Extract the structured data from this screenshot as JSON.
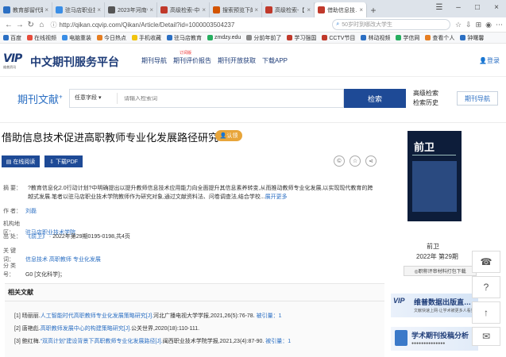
{
  "browser": {
    "tabs": [
      {
        "label": "教育部留代职…",
        "color": "#2b6fc3",
        "active": false
      },
      {
        "label": "驻马店职业技…",
        "color": "#3a8ee6",
        "active": false
      },
      {
        "label": "2023年河南省…",
        "color": "#555555",
        "active": false
      },
      {
        "label": "高级检索-中国…",
        "color": "#c0392b",
        "active": false
      },
      {
        "label": "搜索预览下的…",
        "color": "#d35400",
        "active": false
      },
      {
        "label": "高级检索-【…",
        "color": "#c0392b",
        "active": false
      },
      {
        "label": "借助信息技…",
        "color": "#c0392b",
        "active": true
      }
    ],
    "new_tab": "+",
    "url": "http://qikan.cqvip.com/Qikan/Article/Detail?id=1000003504237",
    "search_placeholder": "50岁时到哪改大学生",
    "bookmarks": [
      {
        "label": "百度",
        "color": "#2b6fc3"
      },
      {
        "label": "在线视频",
        "color": "#e74c3c"
      },
      {
        "label": "电脑重装",
        "color": "#3a8ee6"
      },
      {
        "label": "今日热点",
        "color": "#e67e22"
      },
      {
        "label": "手机收藏",
        "color": "#f1c40f"
      },
      {
        "label": "驻马店教育",
        "color": "#2b6fc3"
      },
      {
        "label": "zmdzy.edu",
        "color": "#27ae60"
      },
      {
        "label": "分前年前了",
        "color": "#888888"
      },
      {
        "label": "学习强国",
        "color": "#c0392b"
      },
      {
        "label": "CCTV节目",
        "color": "#c0392b"
      },
      {
        "label": "林动视频",
        "color": "#2b6fc3"
      },
      {
        "label": "学信网",
        "color": "#27ae60"
      },
      {
        "label": "查看个人",
        "color": "#e67e22"
      },
      {
        "label": "钟曙馨",
        "color": "#2b6fc3"
      }
    ]
  },
  "site": {
    "logo_text": "VIP",
    "logo_sub": "维普资讯",
    "title": "中文期刊服务平台",
    "nav": [
      "期刊导航",
      "期刊评价报告",
      "期刊开放获取",
      "下载APP"
    ],
    "nav_badge": "订阅版",
    "login": "登录"
  },
  "search": {
    "brand": "期刊文献",
    "brand_sup": "+",
    "scope": "任意字段",
    "placeholder": "请输入检索词",
    "button": "检索",
    "advanced": "高级检索",
    "history": "检索历史",
    "journal_nav": "期刊导航"
  },
  "article": {
    "title": "借助信息技术促进高职教师专业化发展路径研究",
    "certified": "认领",
    "read_online": "在线阅读",
    "download_pdf": "下载PDF",
    "abstract_label": "摘 要：",
    "abstract": "?教育信息化2.0行动计划?中明确提出以提升教师信息技术应用能力向全面提升其信息素养转变,从而推动教师专业化发展,以实现现代教育的跨越式发展.笔者以驻马店职业技术学院教师作为研究对象,通过文献资料法、问卷调查法,结合学校...",
    "more": "展开更多",
    "author_label": "作 者：",
    "author": "刘磊",
    "org_label": "机构地区：",
    "org": "驻马店职业技术学院",
    "source_label": "出 处：",
    "source_journal": "《前卫》",
    "source_detail": "2022年第29期0195-0198,共4页",
    "keywords_label": "关 键 词：",
    "keywords": [
      "信息技术",
      "高职教师",
      "专业化发展"
    ],
    "class_label": "分 类 号：",
    "class": "G0 [文化科学]；",
    "related_heading": "相关文献",
    "refs": [
      {
        "n": "[1]",
        "author": "旸丽丽.",
        "title": "人工智能时代高职教师专业化发展策略研究[J].",
        "src": "河北广播电视大学学报,2021,26(5):76-78.",
        "cited": "被引量：1"
      },
      {
        "n": "[2]",
        "author": "唐艳彪.",
        "title": "高职教师发展中心的构建策略研究[J].",
        "src": "公关世界,2020(18):110-111.",
        "cited": ""
      },
      {
        "n": "[3]",
        "author": "鲍红梅.",
        "title": "“双高计划”建设背景下高职教师专业化发展路径[J].",
        "src": "闽西职业技术学院学报,2021,23(4):87-90.",
        "cited": "被引量：1"
      }
    ]
  },
  "sidebar": {
    "cover_title": "前卫",
    "journal_name": "前卫",
    "issue": "2022年 第29期",
    "order_btn": "◎职称评审材料打包下载",
    "ad1_logo": "VIP",
    "ad1_title": "维普数据出版直…",
    "ad1_sub": "文献快速上网·让学术被更多人看见",
    "ad2_title": "学术期刊投稿分析",
    "ad2_sub": "●●●●●●●●●●●●●●"
  },
  "colors": {
    "brand": "#1e4a96",
    "link": "#2b6fc3",
    "badge": "#e8a53a"
  }
}
